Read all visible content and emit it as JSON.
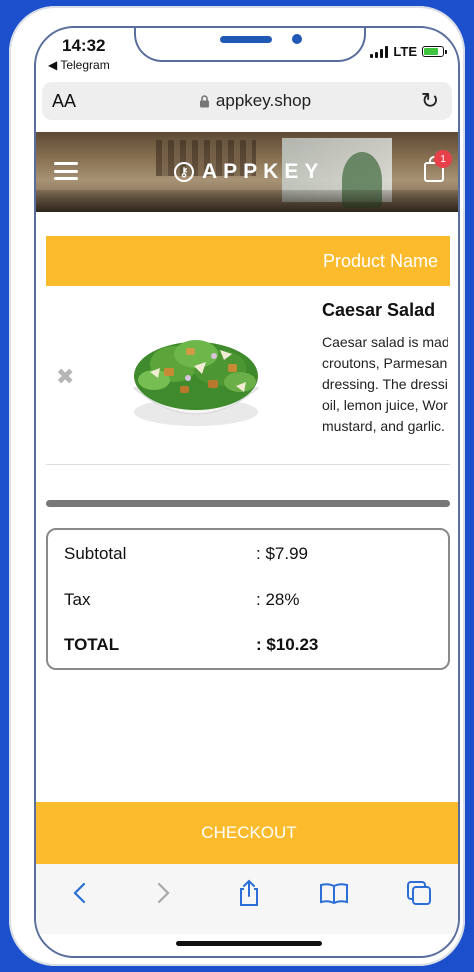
{
  "status": {
    "time": "14:32",
    "back_app": "◀ Telegram",
    "network": "LTE"
  },
  "browser": {
    "text_size": "AA",
    "url": "appkey.shop"
  },
  "header": {
    "brand": "APPKEY",
    "cart_count": "1"
  },
  "product_table": {
    "header": "Product Name"
  },
  "product": {
    "name": "Caesar Salad",
    "description": [
      "Caesar salad is made",
      "croutons, Parmesan c",
      "dressing. The dressin",
      "oil, lemon juice, Worc",
      "mustard, and garlic."
    ]
  },
  "summary": {
    "subtotal_label": "Subtotal",
    "subtotal_value": ": $7.99",
    "tax_label": "Tax",
    "tax_value": ": 28%",
    "total_label": "TOTAL",
    "total_value": ": $10.23"
  },
  "checkout_label": "CHECKOUT",
  "colors": {
    "accent": "#fbbb2d",
    "badge": "#e8404b",
    "frame": "#1b4fcb",
    "link": "#2b6fd6"
  }
}
